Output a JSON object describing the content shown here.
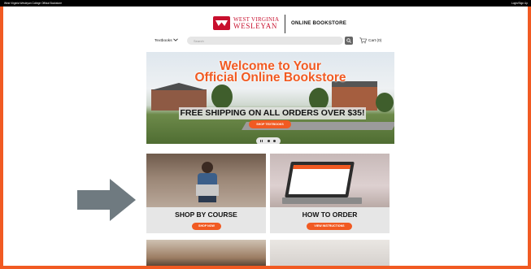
{
  "topbar": {
    "college": "West Virginia Wesleyan College Official Bookstore",
    "account": "Login/Sign Up"
  },
  "header": {
    "school_line1": "WEST VIRGINIA",
    "school_line2": "WESLEYAN",
    "store_name": "ONLINE BOOKSTORE"
  },
  "nav": {
    "textbooks": "Textbooks",
    "search_placeholder": "Search",
    "cart": "Cart (0)"
  },
  "hero": {
    "title_line1": "Welcome to Your",
    "title_line2": "Official Online Bookstore",
    "shipping": "FREE SHIPPING ON ALL ORDERS OVER $35!",
    "button": "SHOP TEXTBOOKS"
  },
  "cards": [
    {
      "title": "SHOP BY COURSE",
      "button": "SHOP NOW"
    },
    {
      "title": "HOW TO ORDER",
      "button": "VIEW INSTRUCTIONS"
    }
  ],
  "colors": {
    "accent": "#f15a22",
    "brand_red": "#c8102e"
  },
  "icons": [
    "chevron-down-icon",
    "search-icon",
    "cart-icon",
    "pause-icon",
    "arrow-right-icon"
  ]
}
